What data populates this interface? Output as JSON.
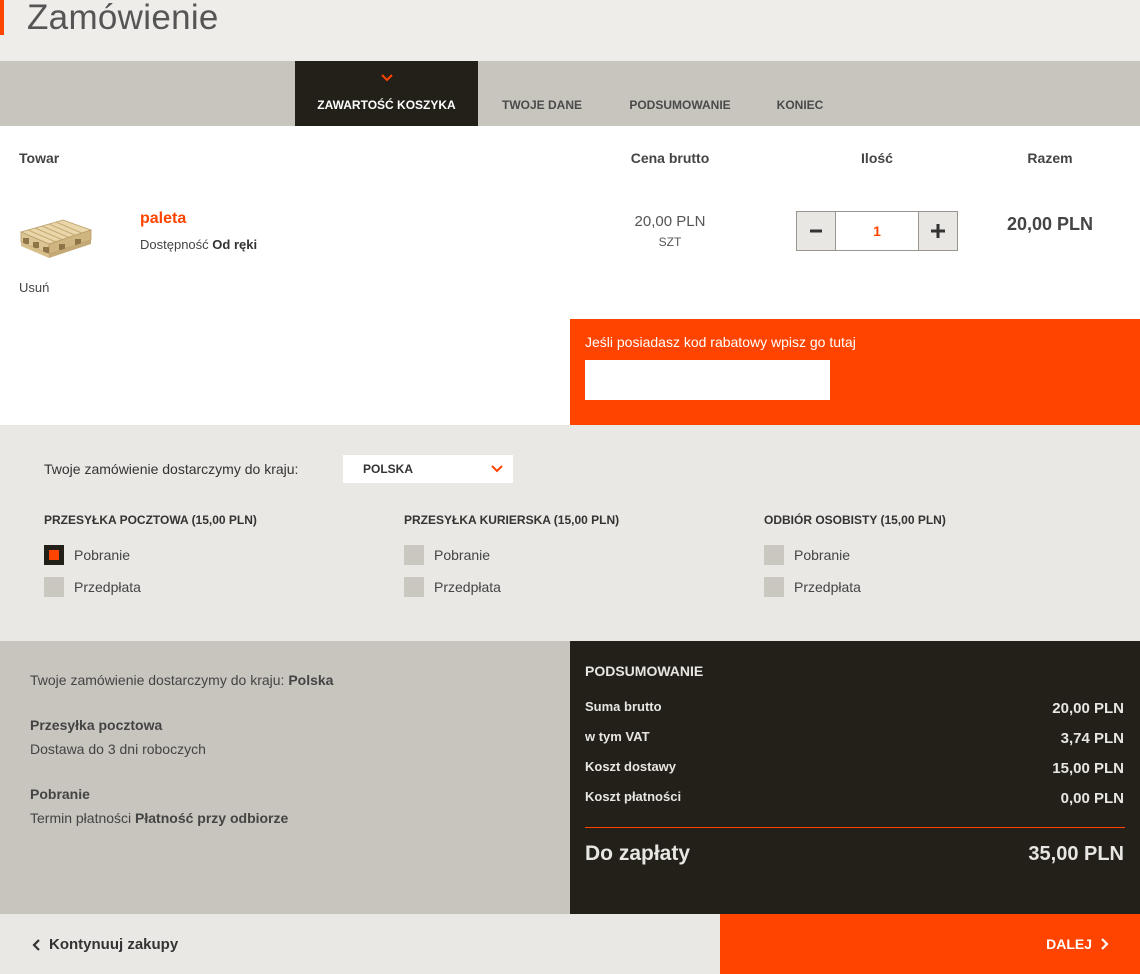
{
  "page": {
    "title": "Zamówienie"
  },
  "steps": [
    {
      "label": "ZAWARTOŚĆ KOSZYKA",
      "active": true
    },
    {
      "label": "TWOJE DANE",
      "active": false
    },
    {
      "label": "PODSUMOWANIE",
      "active": false
    },
    {
      "label": "KONIEC",
      "active": false
    }
  ],
  "cart": {
    "headers": {
      "product": "Towar",
      "price": "Cena brutto",
      "qty": "Ilość",
      "total": "Razem"
    },
    "item": {
      "name": "paleta",
      "availability_label": "Dostępność",
      "availability_value": "Od ręki",
      "remove_label": "Usuń",
      "price": "20,00 PLN",
      "unit": "SZT",
      "quantity": "1",
      "total": "20,00 PLN"
    },
    "icons": {
      "minus": "minus-icon",
      "plus": "plus-icon"
    }
  },
  "coupon": {
    "label": "Jeśli posiadasz kod rabatowy wpisz go tutaj",
    "value": "",
    "placeholder": ""
  },
  "shipping": {
    "country_label": "Twoje zamówienie dostarczymy do kraju:",
    "country_selected": "POLSKA",
    "methods": [
      {
        "title": "PRZESYŁKA POCZTOWA (15,00 PLN)",
        "options": [
          {
            "label": "Pobranie",
            "checked": true
          },
          {
            "label": "Przedpłata",
            "checked": false
          }
        ]
      },
      {
        "title": "PRZESYŁKA KURIERSKA (15,00 PLN)",
        "options": [
          {
            "label": "Pobranie",
            "checked": false
          },
          {
            "label": "Przedpłata",
            "checked": false
          }
        ]
      },
      {
        "title": "ODBIÓR OSOBISTY (15,00 PLN)",
        "options": [
          {
            "label": "Pobranie",
            "checked": false
          },
          {
            "label": "Przedpłata",
            "checked": false
          }
        ]
      }
    ]
  },
  "info": {
    "country_prefix": "Twoje zamówienie dostarczymy do kraju:",
    "country_value": "Polska",
    "shipping_name": "Przesyłka pocztowa",
    "shipping_desc": "Dostawa do 3 dni roboczych",
    "payment_name": "Pobranie",
    "payment_term_prefix": "Termin płatności",
    "payment_term_value": "Płatność przy odbiorze"
  },
  "summary": {
    "title": "PODSUMOWANIE",
    "rows": [
      {
        "label": "Suma brutto",
        "value": "20,00 PLN"
      },
      {
        "label": "w tym VAT",
        "value": "3,74 PLN"
      },
      {
        "label": "Koszt dostawy",
        "value": "15,00 PLN"
      },
      {
        "label": "Koszt płatności",
        "value": "0,00 PLN"
      }
    ],
    "total_label": "Do zapłaty",
    "total_value": "35,00 PLN"
  },
  "footer": {
    "continue_label": "Kontynuuj zakupy",
    "next_label": "DALEJ"
  },
  "colors": {
    "accent": "#ff4400",
    "dark": "#222019",
    "panel": "#c8c5bf",
    "light": "#e9e8e4"
  }
}
